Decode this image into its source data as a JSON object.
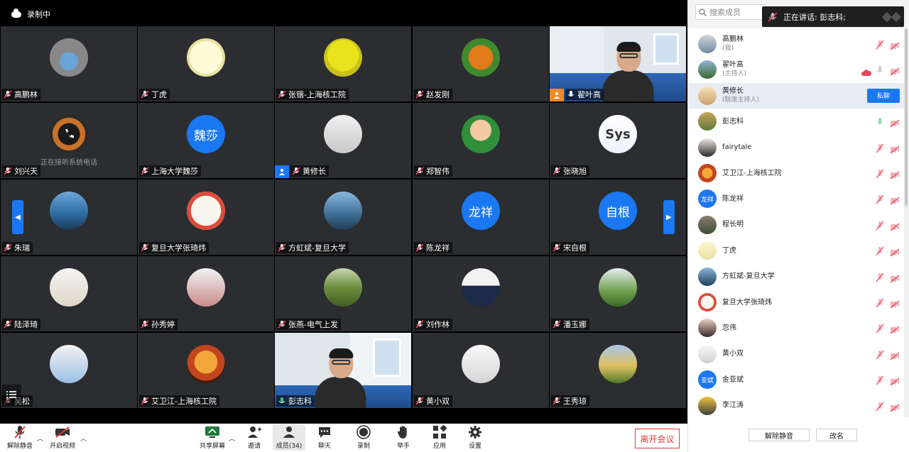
{
  "meeting": {
    "recording_label": "录制中",
    "calling_text": "正在接听系统电话"
  },
  "tiles": [
    {
      "name": "高鹏林"
    },
    {
      "name": "丁虎"
    },
    {
      "name": "张锴-上海核工院"
    },
    {
      "name": "赵发刚"
    },
    {
      "name": "翟叶高"
    },
    {
      "name": "刘兴天"
    },
    {
      "name": "上海大学魏莎",
      "avatar_text": "魏莎"
    },
    {
      "name": "黄修长"
    },
    {
      "name": "郑智伟"
    },
    {
      "name": "张晓旭",
      "avatar_text": "Sys"
    },
    {
      "name": "朱瑞"
    },
    {
      "name": "复旦大学张琦炜"
    },
    {
      "name": "方虹斌-复旦大学"
    },
    {
      "name": "陈龙祥",
      "avatar_text": "龙祥"
    },
    {
      "name": "宋自根",
      "avatar_text": "自根"
    },
    {
      "name": "陆泽琦"
    },
    {
      "name": "孙秀婷"
    },
    {
      "name": "张燕-电气上发"
    },
    {
      "name": "刘作林"
    },
    {
      "name": "潘玉娜"
    },
    {
      "name": "吴松"
    },
    {
      "name": "艾卫江-上海核工院"
    },
    {
      "name": "彭志科"
    },
    {
      "name": "黄小双"
    },
    {
      "name": "王秀琼"
    }
  ],
  "toolbar": {
    "unmute": "解除静音",
    "start_video": "开启视频",
    "share_screen": "共享屏幕",
    "invite": "邀请",
    "members": "成员(34)",
    "chat": "聊天",
    "record": "录制",
    "raise_hand": "举手",
    "apps": "应用",
    "settings": "设置",
    "leave": "离开会议"
  },
  "panel": {
    "search_placeholder": "搜索成员",
    "speaking_label": "正在讲话: 彭志科;",
    "mute_button": "私聊",
    "unmute_all": "解除静音",
    "rename": "改名",
    "participants": [
      {
        "name": "高鹏林",
        "role": "(我)"
      },
      {
        "name": "翟叶高",
        "role": "(主持人)"
      },
      {
        "name": "黄修长",
        "role": "(联席主持人)"
      },
      {
        "name": "彭志科",
        "role": ""
      },
      {
        "name": "fairytale",
        "role": ""
      },
      {
        "name": "艾卫江-上海核工院",
        "role": ""
      },
      {
        "name": "陈龙祥",
        "role": "",
        "avatar_text": "龙祥"
      },
      {
        "name": "程长明",
        "role": ""
      },
      {
        "name": "丁虎",
        "role": ""
      },
      {
        "name": "方虹斌-复旦大学",
        "role": ""
      },
      {
        "name": "复旦大学张琦炜",
        "role": ""
      },
      {
        "name": "忽伟",
        "role": ""
      },
      {
        "name": "黄小双",
        "role": ""
      },
      {
        "name": "金亚斌",
        "role": "",
        "avatar_text": "亚斌"
      },
      {
        "name": "李江涛",
        "role": ""
      }
    ]
  },
  "colors": {
    "accent": "#1a78f2",
    "leave_red": "#e53935",
    "muted_red": "#e8465a",
    "tile_bg": "#2b2d30"
  }
}
